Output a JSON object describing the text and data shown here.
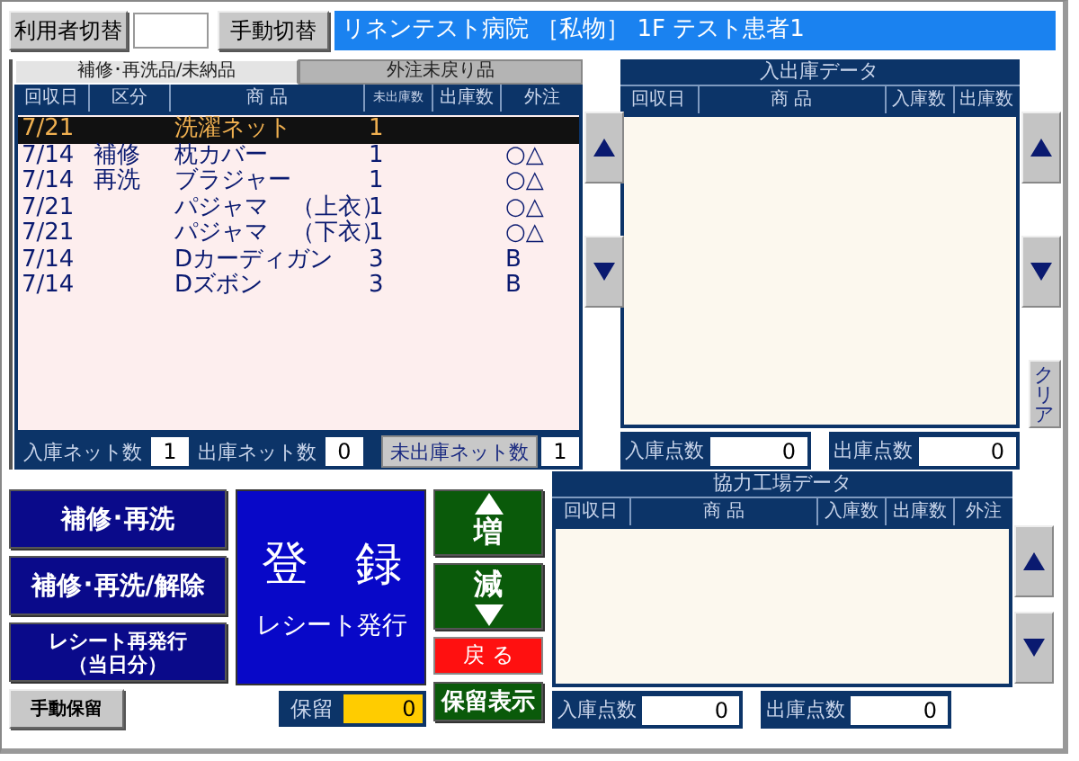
{
  "top_bar": {
    "user_switch_button": "利用者切替",
    "manual_switch_button": "手動切替",
    "title": "リネンテスト病院 ［私物］ 1F テスト患者1"
  },
  "left_panel": {
    "tabs": [
      {
        "label": "補修･再洗品/未納品",
        "selected": true
      },
      {
        "label": "外注未戻り品",
        "selected": false
      }
    ],
    "columns": [
      "回収日",
      "区分",
      "商 品",
      "未出庫数",
      "出庫数",
      "外注"
    ],
    "rows": [
      {
        "date": "7/21",
        "item": "洗濯ネット",
        "unshipped": "1",
        "selected": true
      },
      {
        "date": "7/14",
        "category": "補修",
        "item": "枕カバー",
        "unshipped": "1",
        "outsourcing": "○△",
        "selected": false
      },
      {
        "date": "7/14",
        "category": "再洗",
        "item": "ブラジャー",
        "unshipped": "1",
        "outsourcing": "○△",
        "selected": false
      },
      {
        "date": "7/21",
        "item": "パジャマ　（上衣）",
        "unshipped": "1",
        "outsourcing": "○△",
        "selected": false
      },
      {
        "date": "7/21",
        "item": "パジャマ　（下衣）",
        "unshipped": "1",
        "outsourcing": "○△",
        "selected": false
      },
      {
        "date": "7/14",
        "item": "Dカーディガン",
        "unshipped": "3",
        "outsourcing": "B",
        "selected": false
      },
      {
        "date": "7/14",
        "item": "Dズボン",
        "unshipped": "3",
        "outsourcing": "B",
        "selected": false
      }
    ],
    "footer": [
      {
        "kind": "label",
        "label": "入庫ネット数",
        "value": "1"
      },
      {
        "kind": "label",
        "label": "出庫ネット数",
        "value": "0"
      },
      {
        "kind": "button",
        "label": "未出庫ネット数",
        "value": "1"
      }
    ]
  },
  "io_panel": {
    "title": "入出庫データ",
    "columns": [
      "回収日",
      "商 品",
      "入庫数",
      "出庫数"
    ],
    "footer": [
      {
        "label": "入庫点数",
        "value": "0"
      },
      {
        "label": "出庫点数",
        "value": "0"
      }
    ],
    "clear_button": "クリア"
  },
  "action_buttons": [
    {
      "lines": [
        "補修･再洗"
      ]
    },
    {
      "lines": [
        "補修･再洗/解除"
      ]
    },
    {
      "lines": [
        "レシート再発行",
        "（当日分）"
      ]
    }
  ],
  "manual_hold_button": "手動保留",
  "register_button": {
    "title": "登　録",
    "subtitle": "レシート発行"
  },
  "increase_button": "増",
  "decrease_button": "減",
  "back_button": "戻 る",
  "hold_display_button": "保留表示",
  "hold": {
    "label": "保留",
    "value": "0"
  },
  "factory_panel": {
    "title": "協力工場データ",
    "columns": [
      "回収日",
      "商 品",
      "入庫数",
      "出庫数",
      "外注"
    ],
    "footer": [
      {
        "label": "入庫点数",
        "value": "0"
      },
      {
        "label": "出庫点数",
        "value": "0"
      }
    ]
  }
}
